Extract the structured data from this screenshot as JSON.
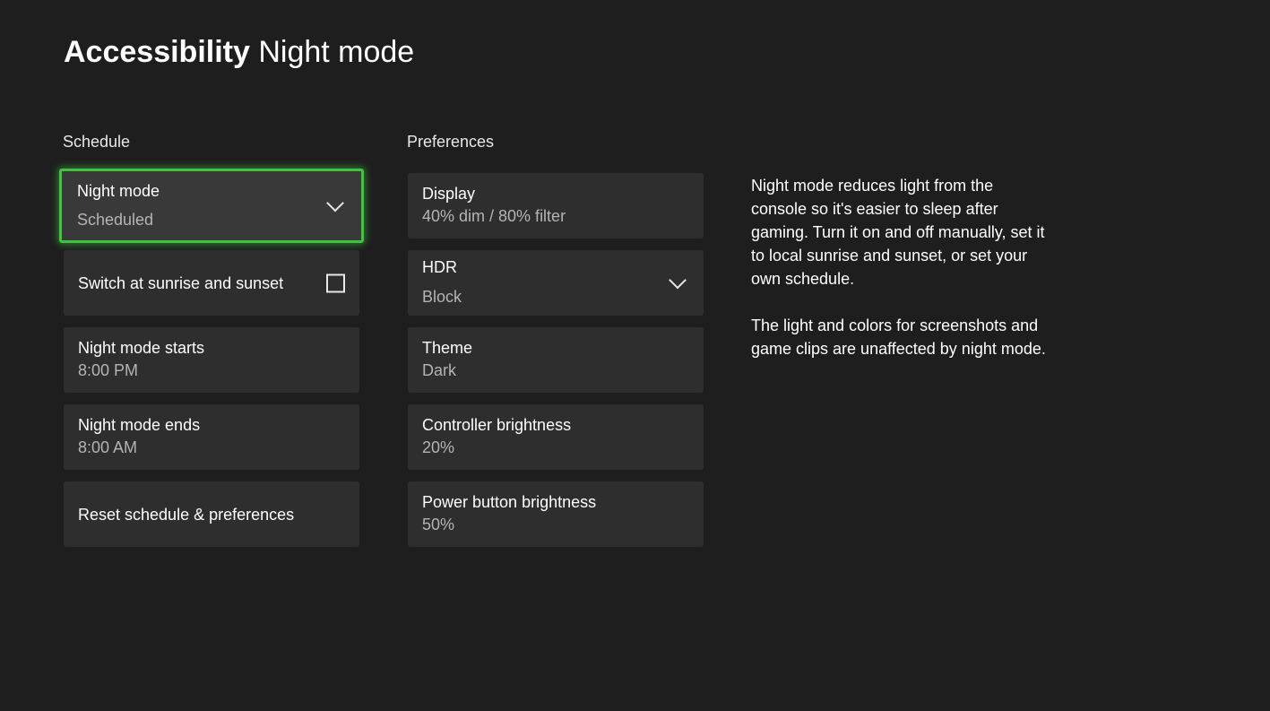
{
  "header": {
    "title_bold": "Accessibility",
    "title_light": "Night mode"
  },
  "schedule": {
    "section_label": "Schedule",
    "night_mode": {
      "label": "Night mode",
      "value": "Scheduled",
      "icon": "chevron-down-icon"
    },
    "sunrise_sunset": {
      "label": "Switch at sunrise and sunset",
      "checked": false
    },
    "starts": {
      "label": "Night mode starts",
      "value": "8:00 PM"
    },
    "ends": {
      "label": "Night mode ends",
      "value": "8:00 AM"
    },
    "reset": {
      "label": "Reset schedule & preferences"
    }
  },
  "preferences": {
    "section_label": "Preferences",
    "display": {
      "label": "Display",
      "value": "40% dim / 80% filter"
    },
    "hdr": {
      "label": "HDR",
      "value": "Block",
      "icon": "chevron-down-icon"
    },
    "theme": {
      "label": "Theme",
      "value": "Dark"
    },
    "controller_brightness": {
      "label": "Controller brightness",
      "value": "20%"
    },
    "power_button_brightness": {
      "label": "Power button brightness",
      "value": "50%"
    }
  },
  "description": {
    "paragraph1": "Night mode reduces light from the console so it's easier to sleep after gaming. Turn it on and off manually, set it to local sunrise and sunset, or set your own schedule.",
    "paragraph2": "The light and colors for screenshots and game clips are unaffected by night mode."
  },
  "colors": {
    "background": "#1e1e1e",
    "card": "#2e2e2e",
    "focus_accent": "#3ec43e",
    "secondary_text": "#b4b4b4"
  }
}
